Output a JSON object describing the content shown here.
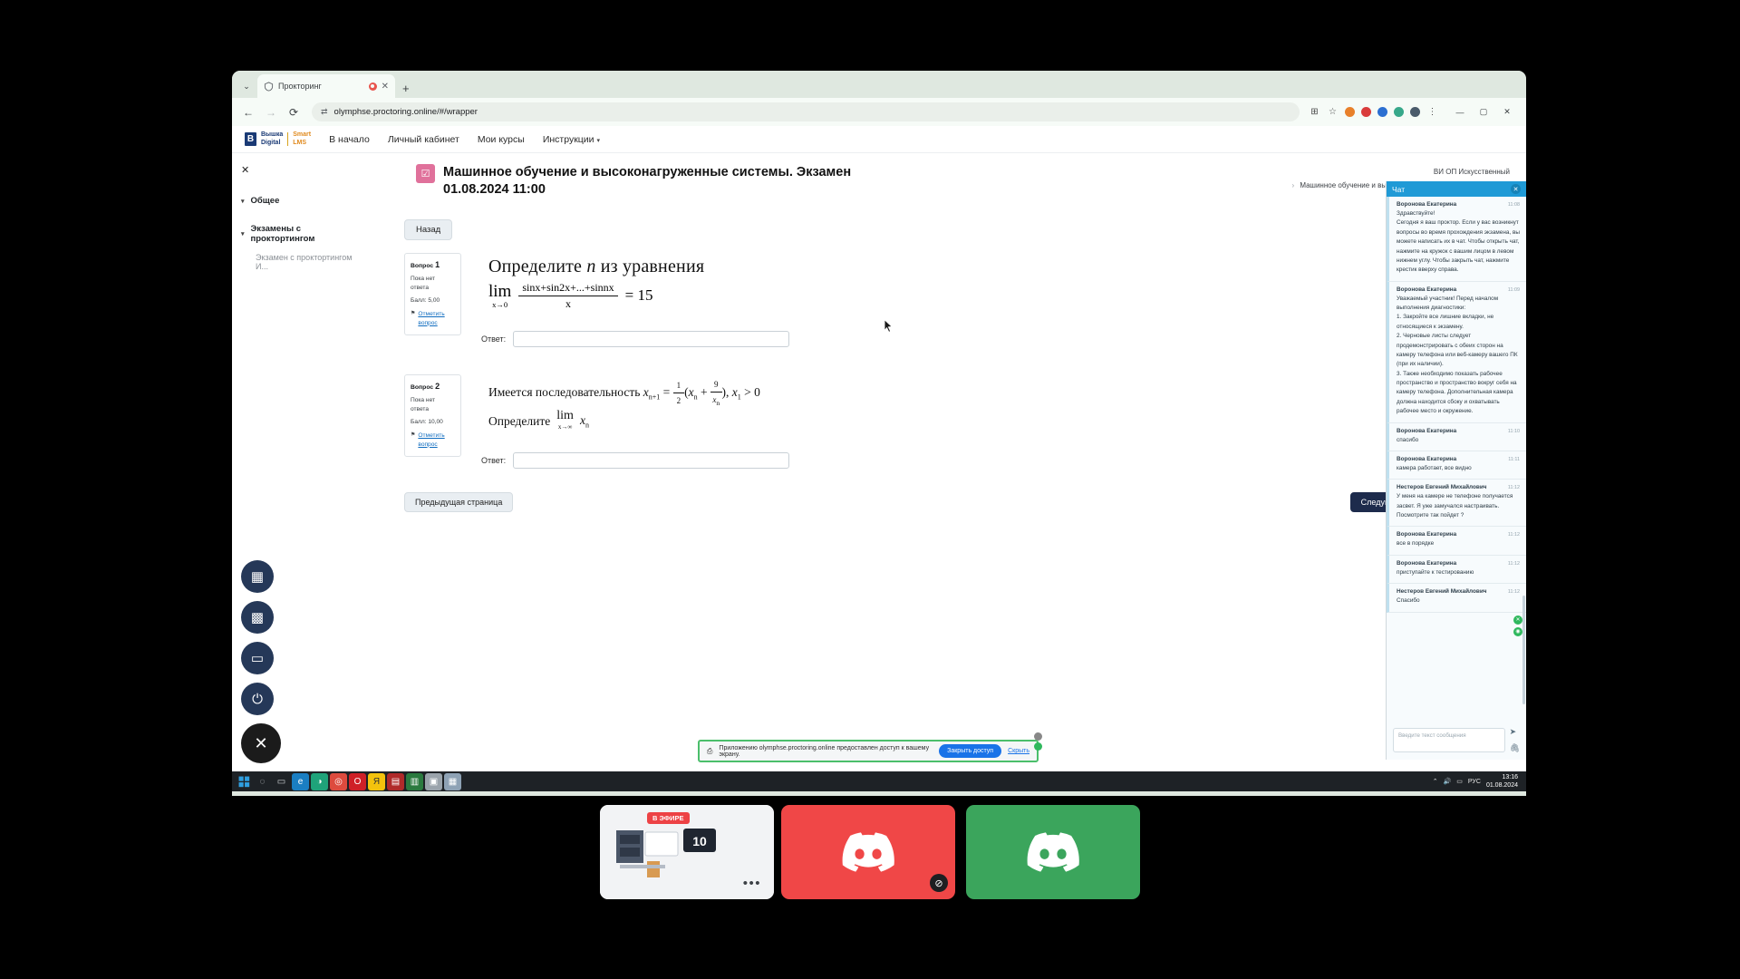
{
  "browser": {
    "tab": {
      "title": "Прокторинг",
      "favicon_icon": "shield-icon",
      "recording_icon": "record-dot-icon",
      "close_icon": "close-icon"
    },
    "new_tab_icon": "plus-icon",
    "nav": {
      "back_icon": "arrow-back-icon",
      "forward_icon": "arrow-forward-icon",
      "reload_icon": "reload-icon"
    },
    "omnibox": {
      "url": "olymphse.proctoring.online/#/wrapper",
      "site_info_icon": "tune-icon"
    },
    "toolbar_icons": [
      "share-screen-icon",
      "bookmark-star-icon",
      "extension-orange-icon",
      "extension-red-icon",
      "extension-blue-icon",
      "extension-teal-icon",
      "profile-avatar-icon",
      "more-menu-icon"
    ],
    "window_controls": {
      "minimize": "—",
      "maximize": "▢",
      "close": "✕"
    }
  },
  "lms": {
    "brand": {
      "mark": "В",
      "line1": "Вышка",
      "line2": "Digital",
      "right1": "Smart",
      "right2": "LMS"
    },
    "nav_links": [
      "В начало",
      "Личный кабинет",
      "Мои курсы",
      "Инструкции"
    ],
    "nav_caret_icon": "chevron-down-icon"
  },
  "drawer": {
    "close_icon": "close-icon",
    "sections": [
      {
        "label": "Общее",
        "caret_icon": "chevron-down-icon"
      },
      {
        "label": "Экзамены с проктортингом",
        "caret_icon": "chevron-down-icon"
      }
    ],
    "sub_item": "Экзамен с проктортингом И..."
  },
  "exam": {
    "icon": "quiz-check-icon",
    "title_line1": "Машинное обучение и высоконагруженные системы. Экзамен",
    "title_line2": "01.08.2024 11:00",
    "breadcrumb_top": "ВИ ОП Искусственный",
    "breadcrumb_bottom": "Машинное обучение и высоконагруженные системы. Экзамен",
    "breadcrumb_sep_icon": "chevron-right-icon",
    "back_label": "Назад"
  },
  "questions": [
    {
      "number_label": "Вопрос",
      "number": "1",
      "status": "Пока нет\nответа",
      "score": "Балл: 5,00",
      "flag_label": "Отметить\nвопрос",
      "flag_icon": "flag-icon",
      "answer_label": "Ответ:",
      "answer_value": "",
      "statement_intro": "Определите",
      "statement_var": "n",
      "statement_tail": "из уравнения",
      "math": {
        "lim": "lim",
        "lim_sub": "x→0",
        "numerator": "sinx+sin2x+...+sinnx",
        "denominator": "x",
        "equals": "= 15"
      }
    },
    {
      "number_label": "Вопрос",
      "number": "2",
      "status": "Пока нет\nответа",
      "score": "Балл: 10,00",
      "flag_label": "Отметить\nвопрос",
      "flag_icon": "flag-icon",
      "answer_label": "Ответ:",
      "answer_value": "",
      "statement_line1": "Имеется последовательность",
      "statement_line2": "Определите",
      "math": {
        "recurrence": "x",
        "lim": "lim",
        "lim_sub": "x→∞"
      }
    }
  ],
  "pager": {
    "prev": "Предыдущая страница",
    "next": "Следующая"
  },
  "proctor_rail": [
    {
      "name": "grid-icon",
      "glyph": "▦"
    },
    {
      "name": "qr-code-icon",
      "glyph": "▩"
    },
    {
      "name": "chat-bubble-icon",
      "glyph": "💬"
    },
    {
      "name": "exit-icon",
      "glyph": "⎋"
    },
    {
      "name": "stop-cross-icon",
      "glyph": "✕"
    }
  ],
  "share_bar": {
    "icon": "share-screen-icon",
    "text": "Приложению olymphse.proctoring.online предоставлен доступ к вашему экрану.",
    "stop_label": "Закрыть доступ",
    "hide_label": "Скрыть"
  },
  "chat": {
    "title": "Чат",
    "close_icon": "close-icon",
    "messages": [
      {
        "author": "Воронова Екатерина",
        "time": "11:08",
        "text": "Здравствуйте!\nСегодня я ваш проктор. Если у вас возникнут вопросы во время прохождения экзамена, вы можете написать их в чат. Чтобы открыть чат, нажмите на кружок с вашим лицом в левом нижнем углу. Чтобы закрыть чат, нажмите крестик вверху справа."
      },
      {
        "author": "Воронова Екатерина",
        "time": "11:09",
        "text": "Уважаемый участник! Перед началом выполнения диагностики:\n1. Закройте все лишние вкладки, не относящиеся к экзамену.\n2. Черновые листы следует продемонстрировать с обеих сторон на камеру телефона или веб-камеру вашего ПК (при их наличии).\n3. Также необходимо показать рабочее пространство и пространство вокруг себя на камеру телефона. Дополнительная камера должна находится сбоку и охватывать рабочее место и окружение."
      },
      {
        "author": "Воронова Екатерина",
        "time": "11:10",
        "text": "спасибо"
      },
      {
        "author": "Воронова Екатерина",
        "time": "11:11",
        "text": "камера работает, все видно"
      },
      {
        "author": "Нестеров Евгений Михайлович",
        "time": "11:12",
        "text": "У меня на камере не телефоне получается засвет. Я уже замучался настраивать. Посмотрите так пойдет ?"
      },
      {
        "author": "Воронова Екатерина",
        "time": "11:12",
        "text": "все в порядке"
      },
      {
        "author": "Воронова Екатерина",
        "time": "11:12",
        "text": "приступайте к тестированию"
      },
      {
        "author": "Нестеров Евгений Михайлович",
        "time": "11:12",
        "text": "Спасибо"
      }
    ],
    "input_placeholder": "Введите текст сообщения",
    "send_icon": "send-icon",
    "attach_icon": "attach-icon",
    "badges": [
      {
        "name": "settings-badge-icon",
        "glyph": "✕"
      },
      {
        "name": "camera-badge-icon",
        "glyph": "◉"
      }
    ]
  },
  "taskbar": {
    "start_icon": "windows-start-icon",
    "items": [
      {
        "name": "search-icon",
        "glyph": "🔍"
      },
      {
        "name": "task-view-icon",
        "glyph": "▭"
      },
      {
        "name": "chrome-icon",
        "glyph": "◎"
      },
      {
        "name": "edge-icon",
        "glyph": "◔"
      },
      {
        "name": "opera-icon",
        "glyph": "◉"
      },
      {
        "name": "yandex-icon",
        "glyph": "Я"
      },
      {
        "name": "app-icon-1",
        "glyph": "▤"
      },
      {
        "name": "app-icon-2",
        "glyph": "▥"
      },
      {
        "name": "folder-icon",
        "glyph": "▣"
      },
      {
        "name": "app-icon-3",
        "glyph": "▦"
      }
    ],
    "tray": {
      "chevron_icon": "chevron-up-icon",
      "volume_icon": "volume-icon",
      "network_icon": "network-icon",
      "lang": "РУС",
      "time": "13:16",
      "date": "01.08.2024"
    }
  },
  "discord_overlay": {
    "share_tile": {
      "live_label": "В ЭФИРЕ",
      "more_icon": "more-dots-icon",
      "counter": "10"
    },
    "tiles": [
      {
        "name": "discord-avatar-red",
        "color": "#f04747",
        "muted_icon": "mic-muted-icon"
      },
      {
        "name": "discord-avatar-green",
        "color": "#3ba55c",
        "muted_icon": ""
      }
    ]
  }
}
